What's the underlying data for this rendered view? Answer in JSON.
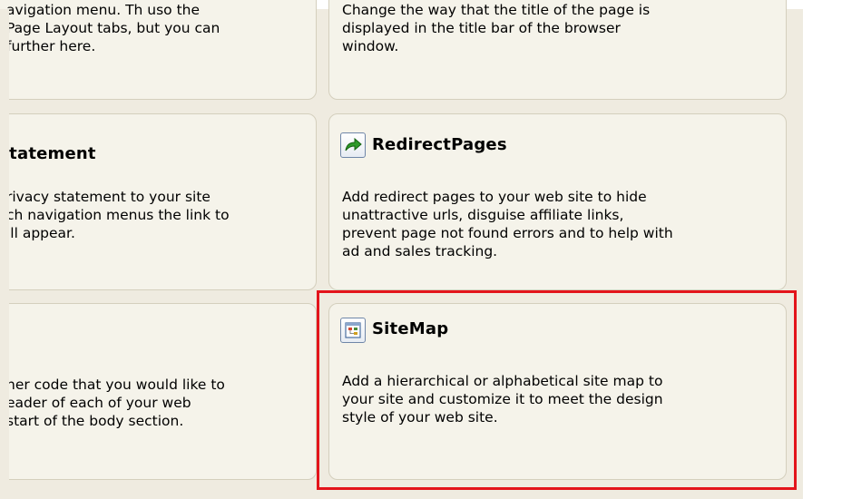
{
  "cards": {
    "top_left": {
      "desc_lines": [
        "avigation menu. Th uso the",
        "Page Layout tabs, but you can",
        "further here."
      ]
    },
    "top_right": {
      "desc_lines": [
        "Change the way that the title of the page is",
        "displayed in the title bar of the browser",
        "window."
      ]
    },
    "mid_left": {
      "title": "Statement",
      "desc_lines": [
        "rivacy statement to your site",
        "ch navigation menus the link to",
        "ill appear."
      ]
    },
    "redirect": {
      "title": "RedirectPages",
      "icon": "green-arrow-icon",
      "desc_lines": [
        "Add redirect pages to your web site to hide",
        "unattractive urls, disguise affiliate links,",
        "prevent page not found errors and to help with",
        "ad and sales tracking."
      ]
    },
    "bottom_left": {
      "desc_lines": [
        "her code that you would like to",
        "eader of each of your web",
        "start of the body section."
      ]
    },
    "sitemap": {
      "title": "SiteMap",
      "icon": "sitemap-icon",
      "desc_lines": [
        "Add a hierarchical or alphabetical site map to",
        "your site and customize it to meet the design",
        "style of your web site."
      ]
    }
  },
  "colors": {
    "panel_background": "#efebe0",
    "card_background": "#f5f3ea",
    "card_border": "#d4cfbd",
    "highlight_border": "#e3141b",
    "icon_arrow": "#2f9a2a"
  }
}
